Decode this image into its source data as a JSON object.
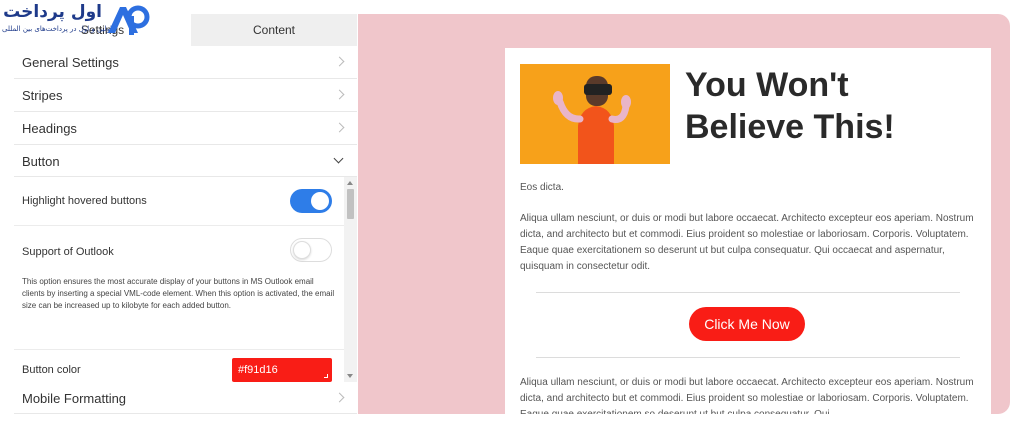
{
  "logo": {
    "title": "اول پرداخت",
    "subtitle": "اولین و اول در پرداخت‌های بین المللی",
    "mark": "AP"
  },
  "tabs": {
    "settings": "Settings",
    "content": "Content"
  },
  "sections": {
    "general": "General Settings",
    "stripes": "Stripes",
    "headings": "Headings",
    "button": "Button",
    "mobile": "Mobile Formatting"
  },
  "button_settings": {
    "highlight_label": "Highlight hovered buttons",
    "highlight_on": true,
    "outlook_label": "Support of Outlook",
    "outlook_on": false,
    "outlook_description": "This option ensures the most accurate display of your buttons in MS Outlook email clients by inserting a special VML-code element. When this option is activated, the email size can be increased up to kilobyte for each added button.",
    "color_label": "Button color",
    "color_value": "#f91d16"
  },
  "colors": {
    "accent": "#2e7de8",
    "button": "#f91d16",
    "preview_bg": "#f0c6cb",
    "hero_bg": "#f7a11a"
  },
  "email": {
    "heading": "You Won't Believe This!",
    "intro": "Eos dicta.",
    "paragraph1": "Aliqua ullam nesciunt, or duis or modi but labore occaecat. Architecto excepteur eos aperiam. Nostrum dicta, and architecto but et commodi. Eius proident so molestiae or laboriosam. Corporis. Voluptatem. Eaque quae exercitationem so deserunt ut but culpa consequatur. Qui occaecat and aspernatur, quisquam in consectetur odit.",
    "button": "Click Me Now",
    "paragraph2": "Aliqua ullam nesciunt, or duis or modi but labore occaecat. Architecto excepteur eos aperiam. Nostrum dicta, and architecto but et commodi. Eius proident so molestiae or laboriosam. Corporis. Voluptatem. Eaque quae exercitationem so deserunt ut but culpa consequatur. Qui"
  }
}
